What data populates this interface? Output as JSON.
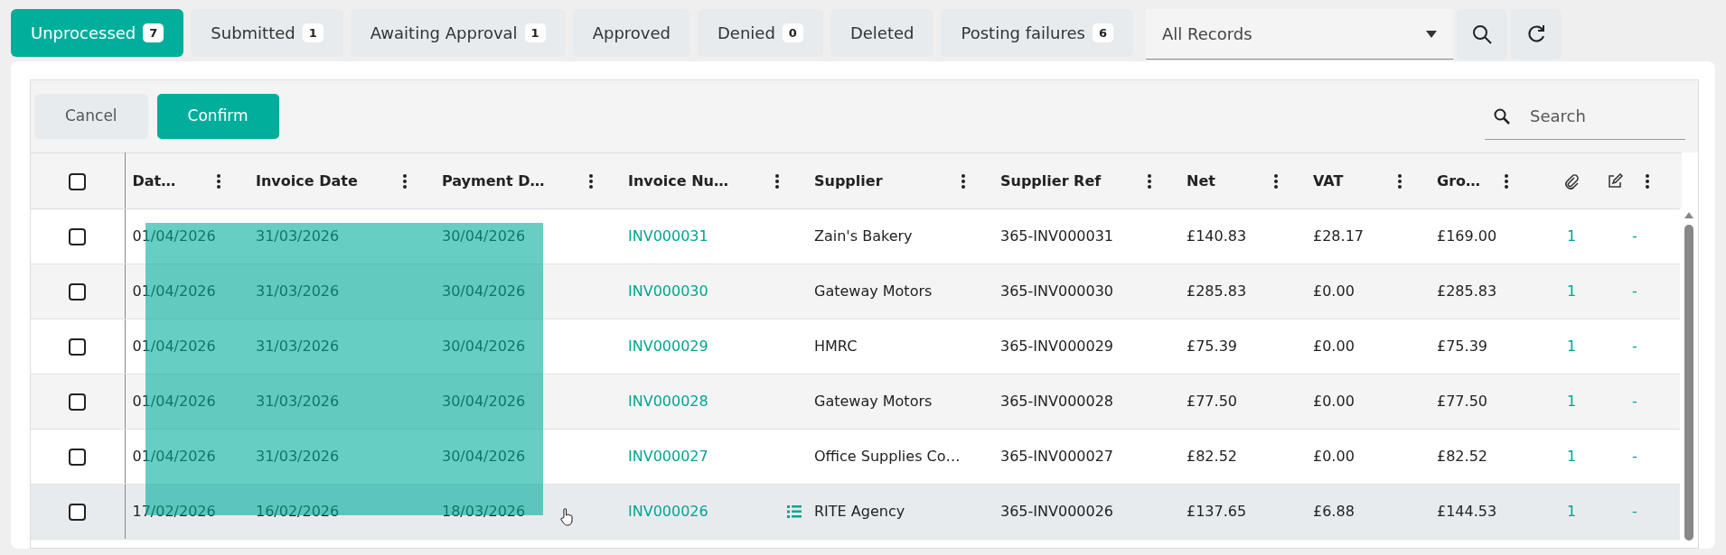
{
  "tabs": [
    {
      "label": "Unprocessed",
      "count": "7",
      "selected": true
    },
    {
      "label": "Submitted",
      "count": "1",
      "selected": false
    },
    {
      "label": "Awaiting Approval",
      "count": "1",
      "selected": false
    },
    {
      "label": "Approved",
      "selected": false
    },
    {
      "label": "Denied",
      "count": "0",
      "selected": false
    },
    {
      "label": "Deleted",
      "selected": false
    },
    {
      "label": "Posting failures",
      "count": "6",
      "selected": false
    }
  ],
  "filter": {
    "value": "All Records"
  },
  "toolbar": {
    "buttons": [
      {
        "label": "Cancel",
        "kind": "secondary"
      },
      {
        "label": "Confirm",
        "kind": "primary"
      }
    ],
    "search": {
      "placeholder": "Search"
    }
  },
  "table": {
    "select_all": {
      "checked": false
    },
    "columns": [
      "Dat…",
      "Invoice Date",
      "Payment D…",
      "Invoice Nu…",
      "Supplier",
      "Supplier Ref",
      "Net",
      "VAT",
      "Gro…"
    ],
    "rows": [
      {
        "checked": false,
        "hovered": false,
        "cells": [
          "01/04/2026",
          "31/03/2026",
          "30/04/2026",
          "INV000031",
          "Zain's Bakery",
          "365-INV000031",
          "£140.83",
          "£28.17",
          "£169.00"
        ],
        "attachments": "1",
        "notes": "-"
      },
      {
        "checked": false,
        "hovered": false,
        "cells": [
          "01/04/2026",
          "31/03/2026",
          "30/04/2026",
          "INV000030",
          "Gateway Motors",
          "365-INV000030",
          "£285.83",
          "£0.00",
          "£285.83"
        ],
        "attachments": "1",
        "notes": "-"
      },
      {
        "checked": false,
        "hovered": false,
        "cells": [
          "01/04/2026",
          "31/03/2026",
          "30/04/2026",
          "INV000029",
          "HMRC",
          "365-INV000029",
          "£75.39",
          "£0.00",
          "£75.39"
        ],
        "attachments": "1",
        "notes": "-"
      },
      {
        "checked": false,
        "hovered": false,
        "cells": [
          "01/04/2026",
          "31/03/2026",
          "30/04/2026",
          "INV000028",
          "Gateway Motors",
          "365-INV000028",
          "£77.50",
          "£0.00",
          "£77.50"
        ],
        "attachments": "1",
        "notes": "-"
      },
      {
        "checked": false,
        "hovered": false,
        "cells": [
          "01/04/2026",
          "31/03/2026",
          "30/04/2026",
          "INV000027",
          "Office Supplies Co…",
          "365-INV000027",
          "£82.52",
          "£0.00",
          "£82.52"
        ],
        "attachments": "1",
        "notes": "-"
      },
      {
        "checked": false,
        "hovered": true,
        "cells": [
          "17/02/2026",
          "16/02/2026",
          "18/03/2026",
          "INV000026",
          "RITE Agency",
          "365-INV000026",
          "£137.65",
          "£6.88",
          "£144.53"
        ],
        "attachments": "1",
        "notes": "-"
      }
    ]
  },
  "drag_selection": {
    "visible": true
  }
}
